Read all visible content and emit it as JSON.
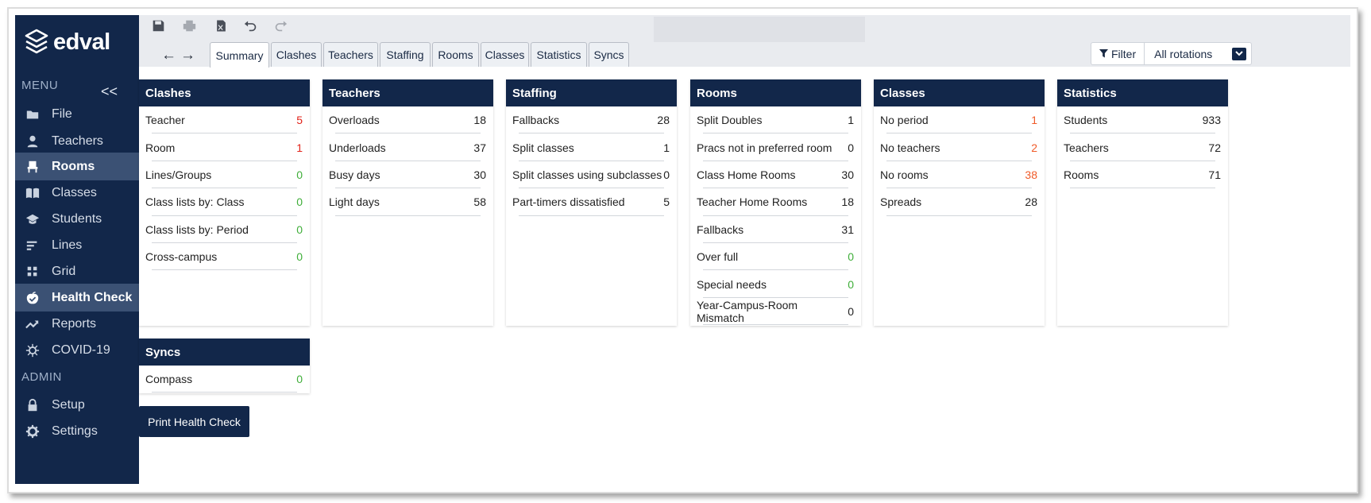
{
  "app": {
    "logo_text": "edval"
  },
  "sidebar": {
    "menu_heading": "MENU",
    "collapse_label": "<<",
    "admin_heading": "ADMIN",
    "items": [
      {
        "label": "File"
      },
      {
        "label": "Teachers"
      },
      {
        "label": "Rooms"
      },
      {
        "label": "Classes"
      },
      {
        "label": "Students"
      },
      {
        "label": "Lines"
      },
      {
        "label": "Grid"
      },
      {
        "label": "Health Check"
      },
      {
        "label": "Reports"
      },
      {
        "label": "COVID-19"
      }
    ],
    "admin_items": [
      {
        "label": "Setup"
      },
      {
        "label": "Settings"
      }
    ]
  },
  "toolbar": {
    "back_label": "←",
    "forward_label": "→",
    "filter_label": "Filter",
    "rotation_value": "All rotations"
  },
  "tabs": [
    {
      "label": "Summary"
    },
    {
      "label": "Clashes"
    },
    {
      "label": "Teachers"
    },
    {
      "label": "Staffing"
    },
    {
      "label": "Rooms"
    },
    {
      "label": "Classes"
    },
    {
      "label": "Statistics"
    },
    {
      "label": "Syncs"
    }
  ],
  "cards": {
    "clashes": {
      "title": "Clashes",
      "rows": [
        {
          "label": "Teacher",
          "value": "5"
        },
        {
          "label": "Room",
          "value": "1"
        },
        {
          "label": "Lines/Groups",
          "value": "0"
        },
        {
          "label": "Class lists by: Class",
          "value": "0"
        },
        {
          "label": "Class lists by: Period",
          "value": "0"
        },
        {
          "label": "Cross-campus",
          "value": "0"
        }
      ]
    },
    "teachers": {
      "title": "Teachers",
      "rows": [
        {
          "label": "Overloads",
          "value": "18"
        },
        {
          "label": "Underloads",
          "value": "37"
        },
        {
          "label": "Busy days",
          "value": "30"
        },
        {
          "label": "Light days",
          "value": "58"
        }
      ]
    },
    "staffing": {
      "title": "Staffing",
      "rows": [
        {
          "label": "Fallbacks",
          "value": "28"
        },
        {
          "label": "Split classes",
          "value": "1"
        },
        {
          "label": "Split classes using subclasses",
          "value": "0"
        },
        {
          "label": "Part-timers dissatisfied",
          "value": "5"
        }
      ]
    },
    "rooms": {
      "title": "Rooms",
      "rows": [
        {
          "label": "Split Doubles",
          "value": "1"
        },
        {
          "label": "Pracs not in preferred room",
          "value": "0"
        },
        {
          "label": "Class Home Rooms",
          "value": "30"
        },
        {
          "label": "Teacher Home Rooms",
          "value": "18"
        },
        {
          "label": "Fallbacks",
          "value": "31"
        },
        {
          "label": "Over full",
          "value": "0"
        },
        {
          "label": "Special needs",
          "value": "0"
        },
        {
          "label": "Year-Campus-Room Mismatch",
          "value": "0"
        }
      ]
    },
    "classes": {
      "title": "Classes",
      "rows": [
        {
          "label": "No period",
          "value": "1"
        },
        {
          "label": "No teachers",
          "value": "2"
        },
        {
          "label": "No rooms",
          "value": "38"
        },
        {
          "label": "Spreads",
          "value": "28"
        }
      ]
    },
    "statistics": {
      "title": "Statistics",
      "rows": [
        {
          "label": "Students",
          "value": "933"
        },
        {
          "label": "Teachers",
          "value": "72"
        },
        {
          "label": "Rooms",
          "value": "71"
        }
      ]
    },
    "syncs": {
      "title": "Syncs",
      "rows": [
        {
          "label": "Compass",
          "value": "0"
        }
      ]
    }
  },
  "colors": {
    "navy": "#12274a",
    "alert_red": "#e2231a",
    "ok_green": "#3fae39",
    "warn_orange": "#f05a28"
  },
  "print_button_label": "Print Health Check"
}
